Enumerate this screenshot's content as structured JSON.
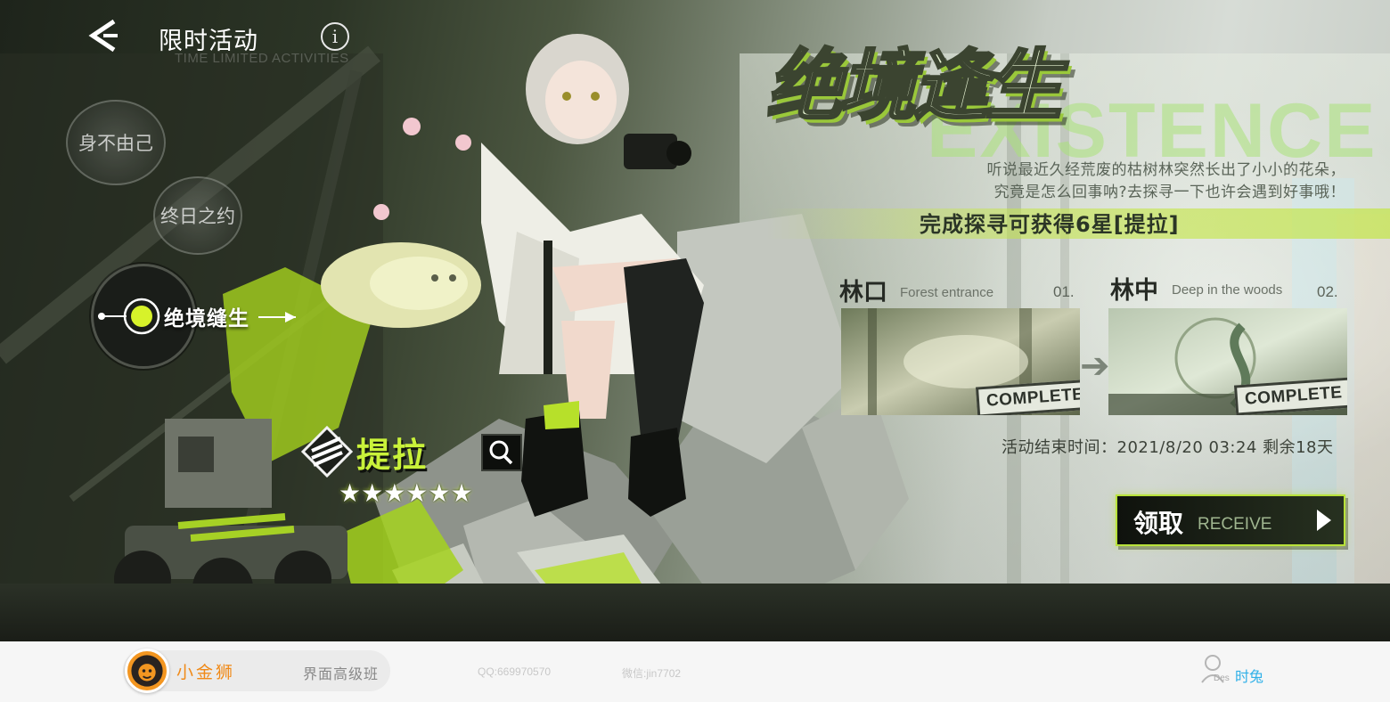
{
  "header": {
    "title": "限时活动",
    "subtitle": "TIME LIMITED ACTIVITIES",
    "info_symbol": "i"
  },
  "tabs": [
    {
      "label": "身不由己",
      "active": false
    },
    {
      "label": "终日之约",
      "active": false
    },
    {
      "label": "绝境缝生",
      "active": true
    }
  ],
  "event": {
    "title": "绝境逢生",
    "title_en": "EXISTENCE",
    "description_line1": "听说最近久经荒废的枯树林突然长出了小小的花朵，",
    "description_line2": "究竟是怎么回事呐?去探寻一下也许会遇到好事哦！",
    "reward": "完成探寻可获得6星[提拉]",
    "stages": [
      {
        "name_zh": "林口",
        "name_en": "Forest entrance",
        "number": "01.",
        "status": "COMPLETE"
      },
      {
        "name_zh": "林中",
        "name_en": "Deep in the woods",
        "number": "02.",
        "status": "COMPLETE"
      }
    ],
    "end_time": "活动结束时间：2021/8/20  03:24  剩余18天",
    "receive_label": "领取",
    "receive_label_en": "RECEIVE"
  },
  "character": {
    "name": "提拉",
    "stars": "★★★★★★",
    "rarity": 6
  },
  "credit": {
    "brand": "小金狮",
    "course": "界面高级班",
    "qq": "QQ:669970570",
    "wechat": "微信:jin7702",
    "user_tag": "Des",
    "user_name": "时兔"
  },
  "colors": {
    "accent_green": "#c9f23a",
    "brand_orange": "#f08a18",
    "user_blue": "#2fb0e8"
  }
}
